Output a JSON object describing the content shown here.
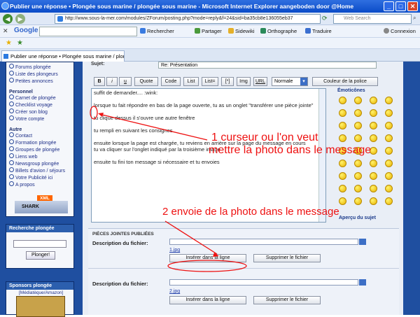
{
  "window": {
    "title": "Publier une réponse • Plongée sous marine / plongée sous marine - Microsoft Internet Explorer aangeboden door @Home"
  },
  "address": {
    "url": "http://www.sous-la-mer.com/modules/ZForum/posting.php?mode=reply&f=24&sid=ba35cb8e136055eb37",
    "web_search_placeholder": "Web Search"
  },
  "google_toolbar": {
    "logo": "Google",
    "items": [
      "Rechercher",
      "Partager",
      "Sidewiki",
      "Orthographe",
      "Traduire",
      "Connexion"
    ]
  },
  "tab": {
    "label": "Publier une réponse • Plongée sous marine / plongée ..."
  },
  "sidebar": {
    "top_items": [
      "Forums plongée",
      "Liste des plongeurs",
      "Petites annonces"
    ],
    "personnel_title": "Personnel",
    "personnel_items": [
      "Carnet de plongée",
      "Checklist voyage",
      "Créer son blog",
      "Votre compte"
    ],
    "autre_title": "Autre",
    "autre_items": [
      "Contact",
      "Formation plongée",
      "Groupes de plongée",
      "Liens web",
      "Newsgroup plongée",
      "Billets d'avion / séjours",
      "Votre Publicité ici",
      "A propos"
    ],
    "xml_badge": "XML",
    "shark_label": "SHARK",
    "search_title": "Recherche plongée",
    "search_button": "Plonger!",
    "sponsors_title": "Sponsors plongée",
    "sponsor_caption": "[Médiatèque/Amazon]"
  },
  "form": {
    "subject_label": "Sujet:",
    "subject_value": "Re: Présentation",
    "buttons": [
      "B",
      "i",
      "u",
      "Quote",
      "Code",
      "List",
      "List=",
      "[*]",
      "Img",
      "URL"
    ],
    "font_size_select": "Normale",
    "color_button": "Couleur de la police",
    "message_lines": [
      "suffit de demander.... :wink:",
      "",
      "lorsque tu fait répondre en bas de la page ouverte, tu as un onglet \"transférer une pièce jointe\"",
      "",
      "tu clique dessus il s'ouvre une autre fenêtre",
      "",
      "tu rempli en suivant les consignes",
      "",
      "ensuite lorsque la page est chargée, tu reviens en arrière sur la page du message en cours",
      "tu va cliquer sur l'onglet  indiqué par la troisième image",
      "",
      "ensuite tu fini ton message si nécessaire et tu envoies"
    ],
    "emoticons_title": "Émoticônes",
    "preview_link": "Aperçu du sujet"
  },
  "attachments": {
    "title": "PIÈCES JOINTES PUBLIÉES",
    "description_label": "Description du fichier:",
    "files": [
      {
        "name": "1.jpg",
        "insert_button": "Insérer dans la ligne",
        "delete_button": "Supprimer le fichier"
      },
      {
        "name": "2.jpg",
        "insert_button": "Insérer dans la ligne",
        "delete_button": "Supprimer le fichier"
      }
    ]
  },
  "annotations": {
    "a1_line1": "1 curseur ou l'on veut",
    "a1_line2": "mettre la photo dans le message",
    "a2": "2 envoie de la photo dans le message",
    "color": "#e11111"
  }
}
